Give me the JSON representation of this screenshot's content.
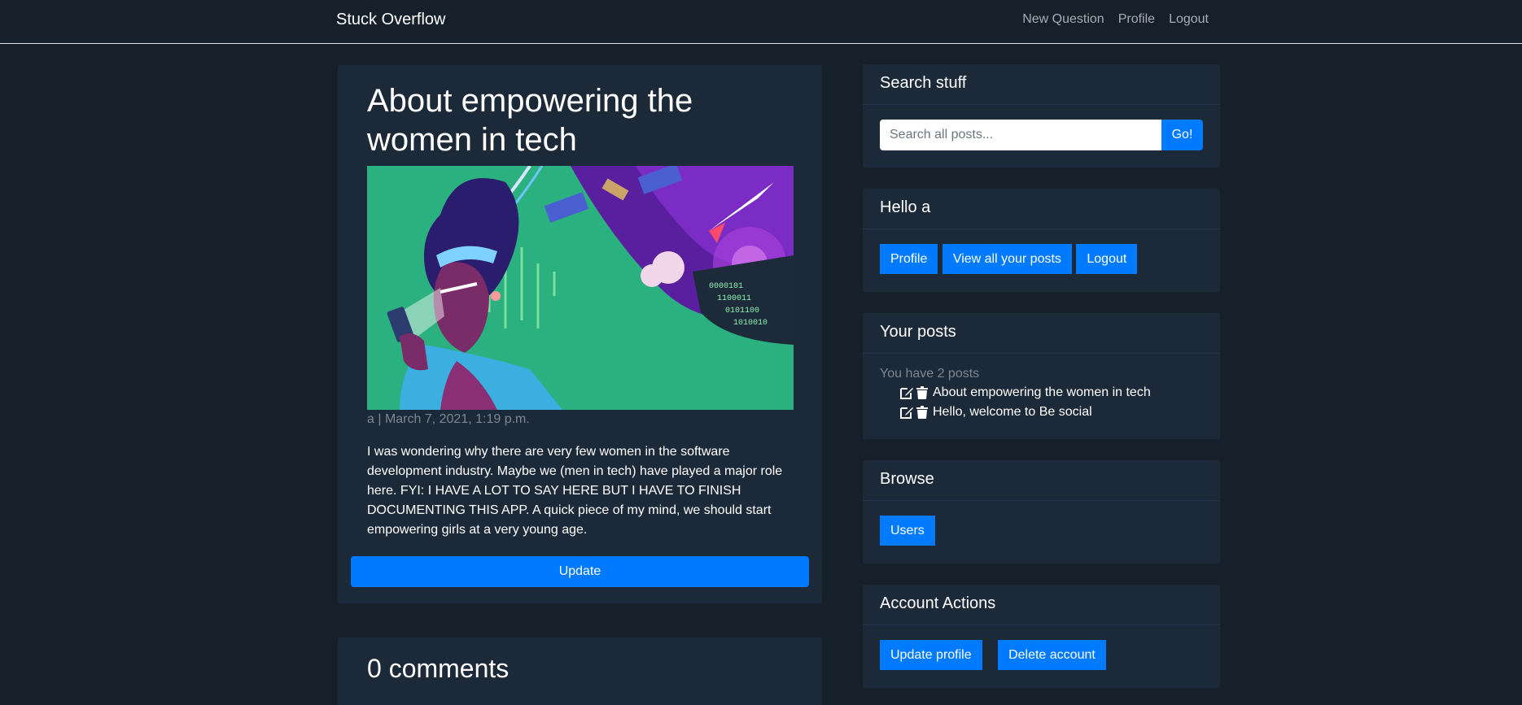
{
  "nav": {
    "brand": "Stuck Overflow",
    "links": [
      "New Question",
      "Profile",
      "Logout"
    ]
  },
  "post": {
    "title": "About empowering the women in tech",
    "meta": "a | March 7, 2021, 1:19 p.m.",
    "body": "I was wondering why there are very few women in the software development industry. Maybe we (men in tech) have played a major role here. FYI: I HAVE A LOT TO SAY HERE BUT I HAVE TO FINISH DOCUMENTING THIS APP. A quick piece of my mind, we should start empowering girls at a very young age.",
    "update_label": "Update"
  },
  "comments": {
    "title": "0 comments"
  },
  "search": {
    "header": "Search stuff",
    "placeholder": "Search all posts...",
    "go_label": "Go!"
  },
  "hello": {
    "header": "Hello a",
    "buttons": [
      "Profile",
      "View all your posts",
      "Logout"
    ]
  },
  "your_posts": {
    "header": "Your posts",
    "count_text": "You have 2 posts",
    "items": [
      "About empowering the women in tech",
      "Hello, welcome to Be social"
    ]
  },
  "browse": {
    "header": "Browse",
    "users_label": "Users"
  },
  "account": {
    "header": "Account Actions",
    "update_label": "Update profile",
    "delete_label": "Delete account"
  },
  "colors": {
    "background": "#15202b",
    "card": "#1c2938",
    "primary": "#007bff",
    "muted": "#7d8791"
  },
  "icons": {
    "edit": "edit-icon",
    "delete": "trash-icon"
  }
}
